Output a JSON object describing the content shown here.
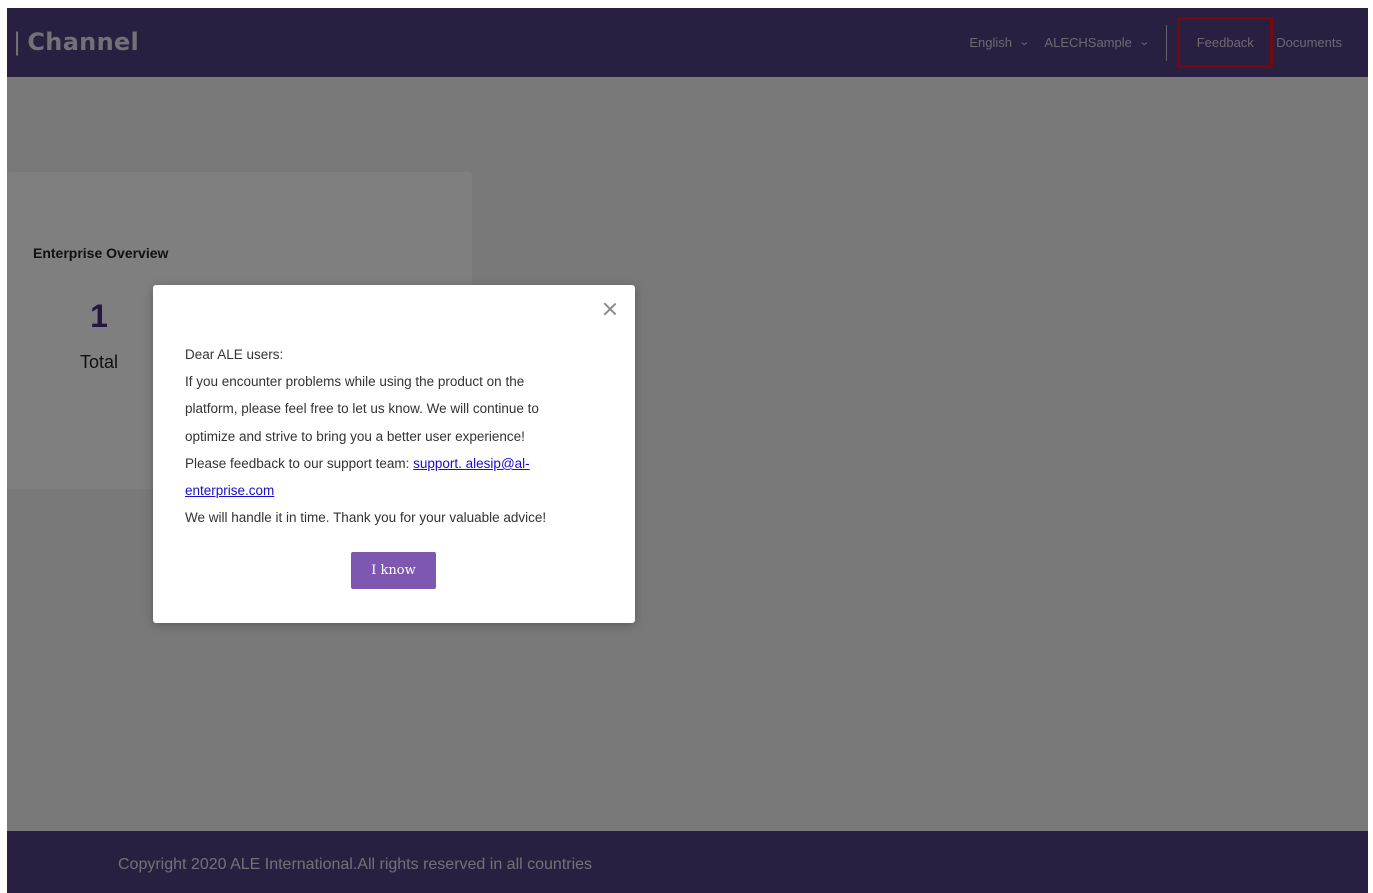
{
  "header": {
    "brand_bar": "|",
    "brand": "Channel",
    "language": "English",
    "account": "ALECHSample",
    "feedback": "Feedback",
    "documents": "Documents"
  },
  "card": {
    "title": "Enterprise Overview",
    "stat_value": "1",
    "stat_label": "Total"
  },
  "modal": {
    "greeting": "Dear ALE users:",
    "paragraph_line1": "If you encounter problems while using the product on the",
    "paragraph_line2": "platform, please feel free to let us know. We will continue to",
    "paragraph_line3": "optimize and strive to bring you a better user experience!",
    "support_prefix": "Please feedback to our support team: ",
    "support_email_line1": "support. alesip@al-",
    "support_email_line2": "enterprise.com",
    "closing": "We will handle it in time. Thank you for your valuable advice!",
    "button": "I know"
  },
  "footer": {
    "copyright": "Copyright 2020 ALE International.All rights reserved in all countries"
  },
  "colors": {
    "brand_purple": "#533f80",
    "button_purple": "#7e57b1",
    "highlight_red": "#e8151b",
    "link_blue": "#1a0dcc"
  },
  "icons": {
    "language_dropdown": "chevron-down-icon",
    "account_dropdown": "chevron-down-icon",
    "modal_close": "close-icon"
  }
}
